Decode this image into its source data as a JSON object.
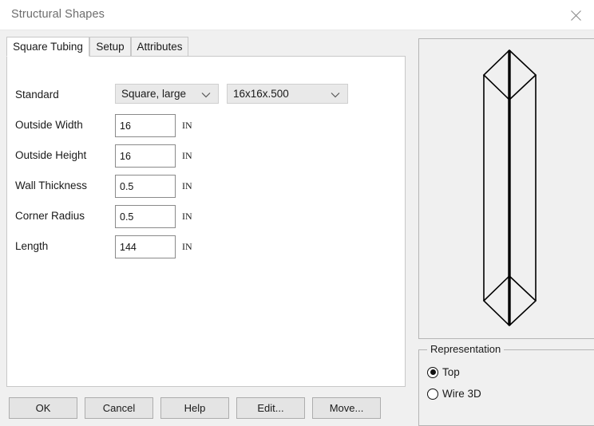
{
  "window": {
    "title": "Structural Shapes",
    "close_icon": "close-icon"
  },
  "tabs": [
    {
      "label": "Square Tubing",
      "active": true
    },
    {
      "label": "Setup",
      "active": false
    },
    {
      "label": "Attributes",
      "active": false
    }
  ],
  "form": {
    "standard": {
      "label": "Standard",
      "type_value": "Square, large",
      "size_value": "16x16x.500",
      "arrow_icon": "chevron-down-icon"
    },
    "fields": [
      {
        "label": "Outside Width",
        "value": "16",
        "unit": "IN"
      },
      {
        "label": "Outside Height",
        "value": "16",
        "unit": "IN"
      },
      {
        "label": "Wall Thickness",
        "value": "0.5",
        "unit": "IN"
      },
      {
        "label": "Corner Radius",
        "value": "0.5",
        "unit": "IN"
      },
      {
        "label": "Length",
        "value": "144",
        "unit": "IN"
      }
    ]
  },
  "preview": {
    "name": "shape-preview",
    "description": "wireframe-square-tube"
  },
  "representation": {
    "legend": "Representation",
    "options": [
      {
        "label": "Top",
        "selected": true
      },
      {
        "label": "Wire 3D",
        "selected": false
      }
    ]
  },
  "footer": {
    "ok": "OK",
    "cancel": "Cancel",
    "help": "Help",
    "edit": "Edit...",
    "move": "Move..."
  },
  "colors": {
    "titlebar_bg": "#ffffff",
    "body_bg": "#f0f0f0",
    "panel_bg": "#ffffff",
    "border": "#c8c8c8",
    "button_bg": "#e4e4e4",
    "dropdown_bg": "#e9e9e9",
    "wireframe_stroke": "#000000"
  }
}
